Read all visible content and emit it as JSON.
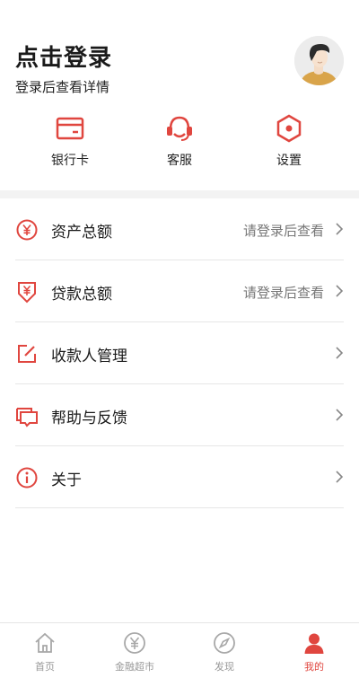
{
  "header": {
    "title": "点击登录",
    "subtitle": "登录后查看详情"
  },
  "quick_actions": [
    {
      "label": "银行卡",
      "icon": "bank-card-icon"
    },
    {
      "label": "客服",
      "icon": "customer-service-icon"
    },
    {
      "label": "设置",
      "icon": "settings-icon"
    }
  ],
  "menu": [
    {
      "label": "资产总额",
      "value": "请登录后查看",
      "icon": "yuan-circle-icon"
    },
    {
      "label": "贷款总额",
      "value": "请登录后查看",
      "icon": "loan-icon"
    },
    {
      "label": "收款人管理",
      "value": "",
      "icon": "edit-icon"
    },
    {
      "label": "帮助与反馈",
      "value": "",
      "icon": "chat-icon"
    },
    {
      "label": "关于",
      "value": "",
      "icon": "info-icon"
    }
  ],
  "tabbar": [
    {
      "label": "首页",
      "icon": "home-icon",
      "active": false
    },
    {
      "label": "金融超市",
      "icon": "yuan-icon",
      "active": false
    },
    {
      "label": "发现",
      "icon": "compass-icon",
      "active": false
    },
    {
      "label": "我的",
      "icon": "user-icon",
      "active": true
    }
  ],
  "colors": {
    "accent": "#e0463f",
    "inactive": "#999999"
  }
}
